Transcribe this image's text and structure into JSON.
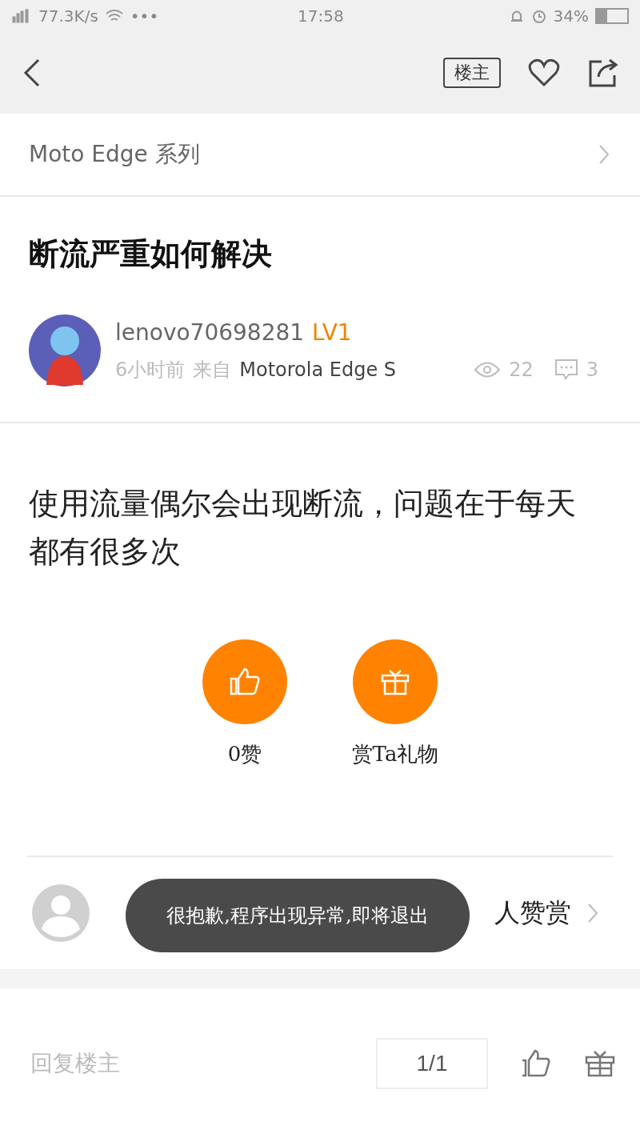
{
  "status_bar": {
    "speed": "77.3K/s",
    "dots": "•••",
    "time": "17:58",
    "battery": "34%"
  },
  "nav": {
    "owner_tag": "楼主"
  },
  "forum": {
    "name": "Moto Edge 系列"
  },
  "post": {
    "title": "断流严重如何解决",
    "author": "lenovo70698281",
    "level": "LV1",
    "time": "6小时前",
    "from_label": "来自",
    "device": "Motorola Edge S",
    "views": "22",
    "comments": "3",
    "body": "使用流量偶尔会出现断流，问题在于每天都有很多次"
  },
  "actions": [
    {
      "kind": "like",
      "label": "0赞"
    },
    {
      "kind": "gift",
      "label": "赏Ta礼物"
    }
  ],
  "reward": {
    "text": "人赞赏"
  },
  "toast": "很抱歉,程序出现异常,即将退出",
  "bottom": {
    "placeholder": "回复楼主",
    "page": "1/1"
  }
}
